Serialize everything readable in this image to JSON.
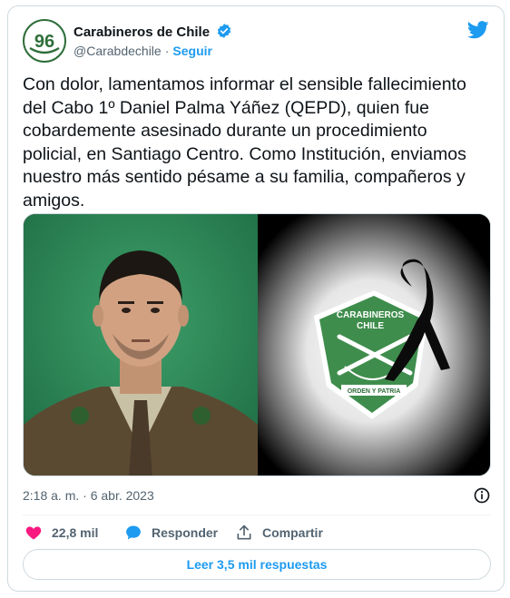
{
  "author": {
    "display_name": "Carabineros de Chile",
    "handle": "@Carabdechile",
    "follow_label": "Seguir",
    "avatar_text": "96",
    "verified": true
  },
  "tweet": {
    "text": "Con dolor, lamentamos informar el sensible fallecimiento\ndel Cabo 1º Daniel Palma Yáñez (QEPD), quien fue\ncobardemente asesinado durante un procedimiento\npolicial, en Santiago Centro. Como Institución, enviamos\nnuestro más sentido pésame a su familia, compañeros y\namigos.",
    "timestamp": "2:18 a. m. · 6 abr. 2023"
  },
  "media": {
    "emblem_line1": "CARABINEROS",
    "emblem_line2": "CHILE",
    "emblem_motto": "ORDEN Y PATRIA"
  },
  "actions": {
    "likes": "22,8 mil",
    "reply_label": "Responder",
    "share_label": "Compartir",
    "read_replies_label": "Leer 3,5 mil respuestas"
  },
  "icons": {
    "like": "heart-icon",
    "reply": "speech-bubble-icon",
    "share": "share-icon",
    "info": "info-icon",
    "brand": "twitter-bird-icon"
  },
  "colors": {
    "accent": "#1d9bf0",
    "like": "#f91880",
    "text": "#0f1419",
    "secondary": "#536471",
    "carabineros_green": "#2e7d32"
  }
}
